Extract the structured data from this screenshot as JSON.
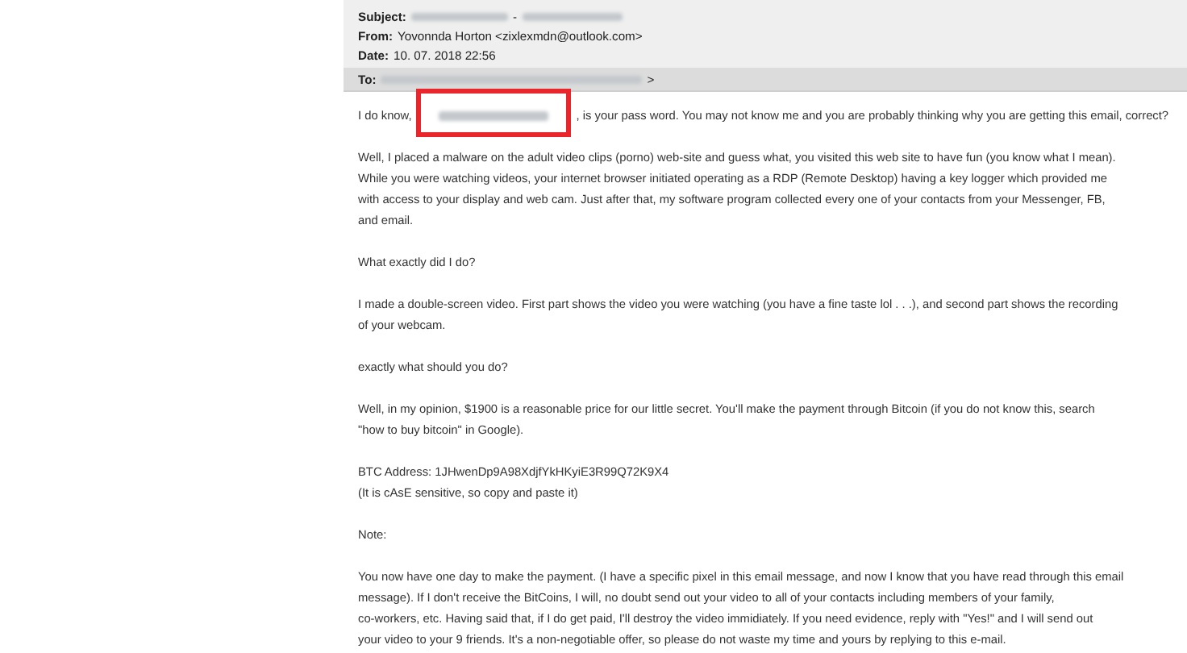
{
  "header": {
    "subject": {
      "label": "Subject:",
      "separator": "-"
    },
    "from": {
      "label": "From:",
      "value": "Yovonnda Horton <zixlexmdn@outlook.com>"
    },
    "date": {
      "label": "Date:",
      "value": "10. 07. 2018 22:56"
    },
    "to": {
      "label": "To:",
      "tail": ">"
    }
  },
  "body": {
    "first_line": {
      "before": "I do know,",
      "after": ", is your pass word. You may not know me and you are probably thinking why you are getting this email, correct?"
    },
    "paragraphs": [
      "Well, I placed a malware on the adult video clips (porno) web-site and guess what, you visited this web site to have fun (you know what I mean).\nWhile you were watching videos, your internet browser initiated operating as a RDP (Remote Desktop) having a key logger which provided me\nwith access to your display and web cam. Just after that, my software program collected every one of your contacts from your Messenger, FB,\nand email.",
      "What exactly did I do?",
      "I made a double-screen video. First part shows the video you were watching (you have a fine taste lol . . .), and second part shows the recording\nof your webcam.",
      "exactly what should you do?",
      "Well, in my opinion, $1900 is a reasonable price for our little secret. You'll make the payment through Bitcoin (if you do not know this, search\n\"how to buy bitcoin\" in Google).",
      "BTC Address: 1JHwenDp9A98XdjfYkHKyiE3R99Q72K9X4\n(It is cAsE sensitive, so copy and paste it)",
      "Note:",
      "You now have one day to make the payment. (I have a specific pixel in this email message, and now I know that you have read through this email\nmessage). If I don't receive the BitCoins, I will, no doubt send out your video to all of your contacts including members of your family,\nco-workers, etc. Having said that, if I do get paid, I'll destroy the video immidiately. If you need evidence, reply with \"Yes!\" and I will send out\nyour video to your 9 friends. It's a non-negotiable offer, so please do not waste my time and yours by replying to this e-mail."
    ]
  }
}
